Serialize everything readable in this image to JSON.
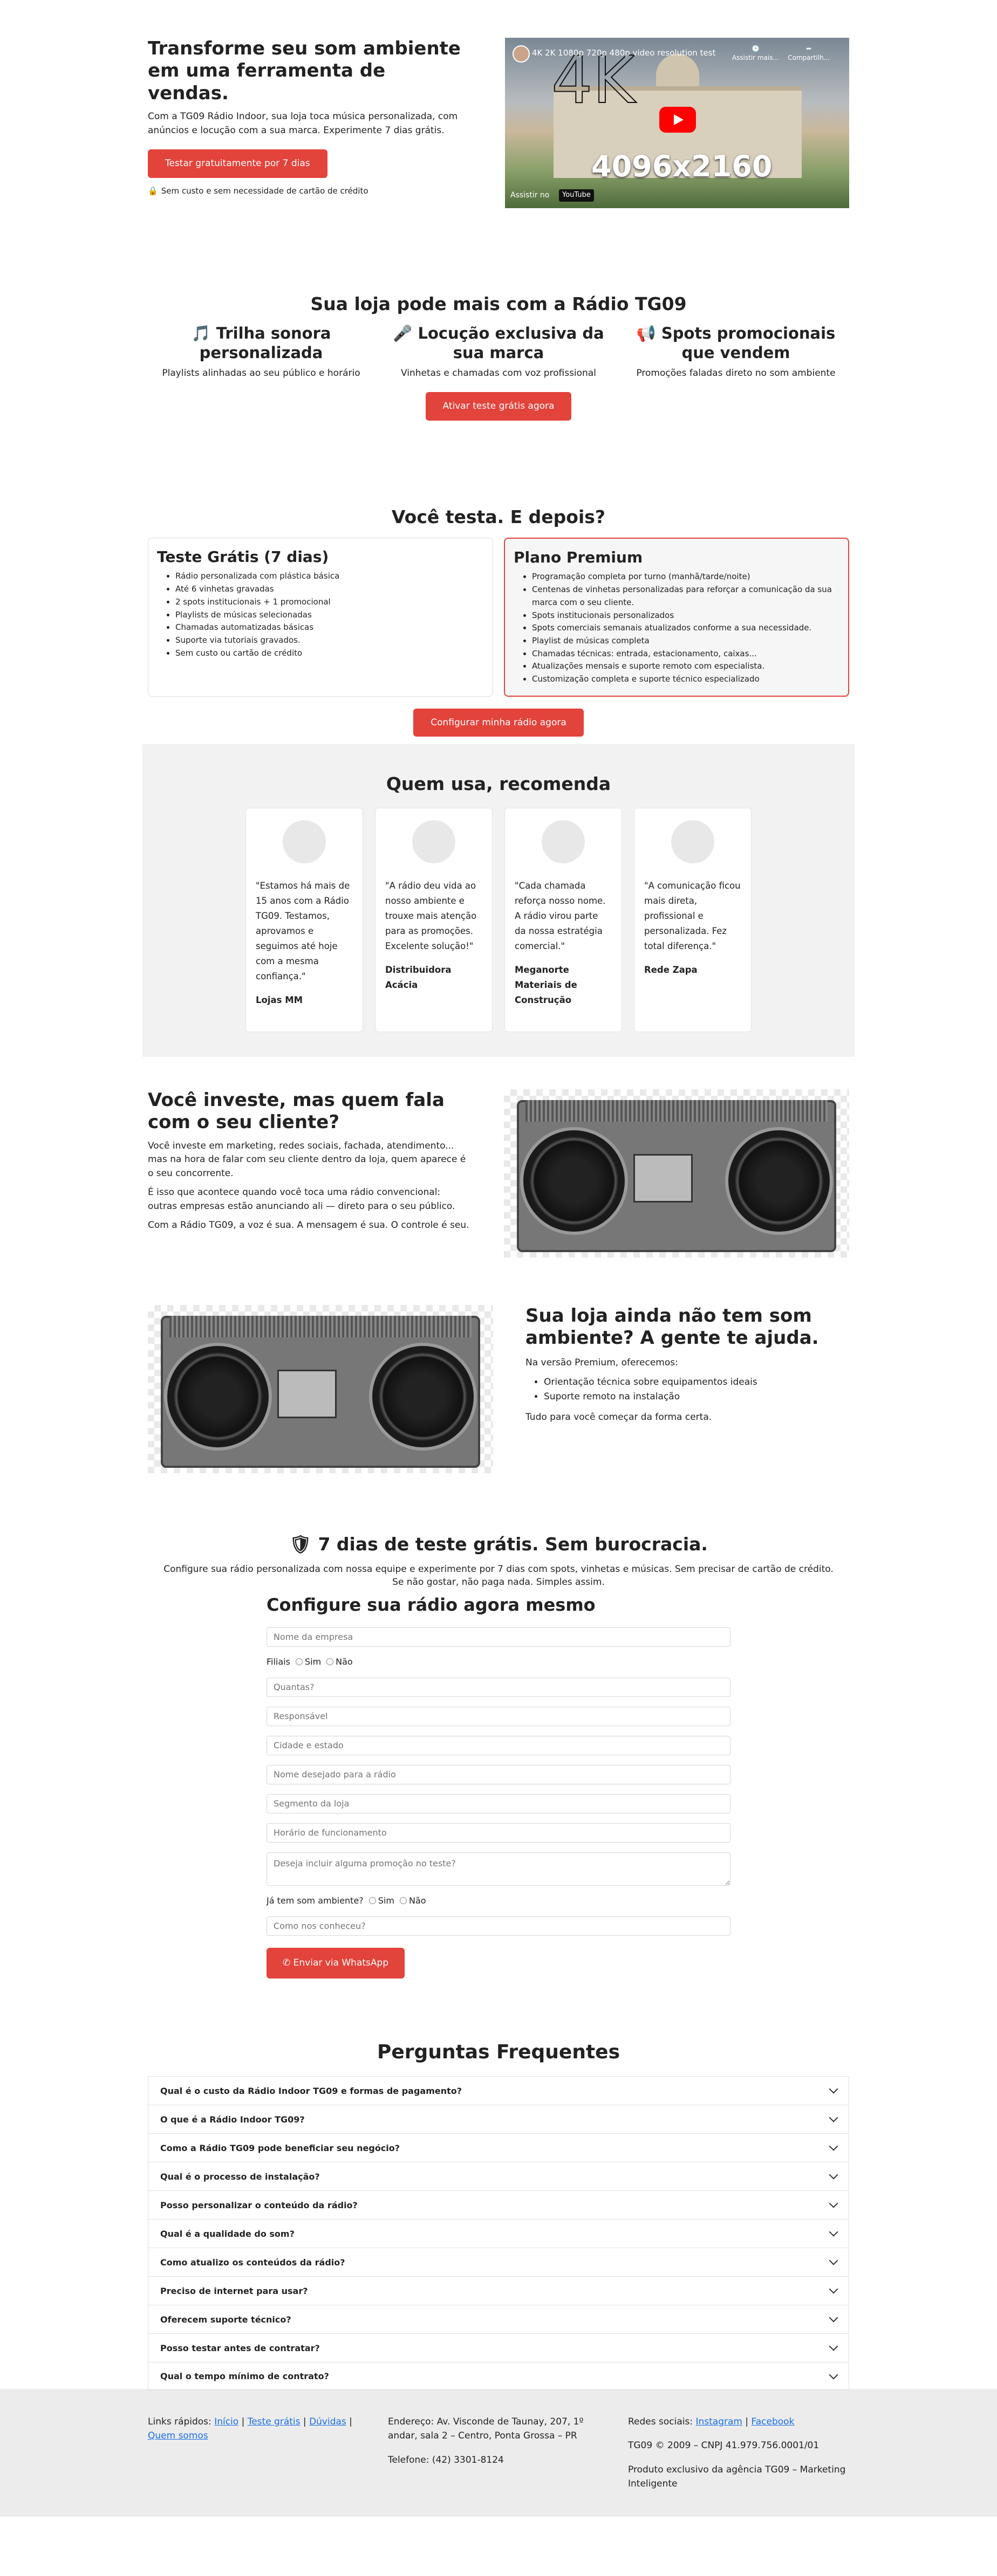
{
  "hero": {
    "title": "Transforme seu som ambiente em uma ferramenta de vendas.",
    "text": "Com a TG09 Rádio Indoor, sua loja toca música personalizada, com anúncios e locução com a sua marca. Experimente 7 dias grátis.",
    "button": "Testar gratuitamente por 7 dias",
    "note": "Sem custo e sem necessidade de cartão de crédito",
    "video": {
      "title": "4K 2K 1080p 720p 480p video resolution test",
      "big_label": "4K",
      "resolution": "4096x2160",
      "watch_on": "Assistir no",
      "platform": "YouTube",
      "later": "Assistir mais...",
      "share": "Compartilh..."
    }
  },
  "features": {
    "title": "Sua loja pode mais com a Rádio TG09",
    "items": [
      {
        "icon": "🎵",
        "title": "Trilha sonora personalizada",
        "text": "Playlists alinhadas ao seu público e horário"
      },
      {
        "icon": "🎤",
        "title": "Locução exclusiva da sua marca",
        "text": "Vinhetas e chamadas com voz profissional"
      },
      {
        "icon": "📢",
        "title": "Spots promocionais que vendem",
        "text": "Promoções faladas direto no som ambiente"
      }
    ],
    "button": "Ativar teste grátis agora"
  },
  "plans": {
    "title": "Você testa. E depois?",
    "free": {
      "title": "Teste Grátis (7 dias)",
      "items": [
        "Rádio personalizada com plástica básica",
        "Até 6 vinhetas gravadas",
        "2 spots institucionais + 1 promocional",
        "Playlists de músicas selecionadas",
        "Chamadas automatizadas básicas",
        "Suporte via tutoriais gravados.",
        "Sem custo ou cartão de crédito"
      ]
    },
    "premium": {
      "title": "Plano Premium",
      "items": [
        "Programação completa por turno (manhã/tarde/noite)",
        "Centenas de vinhetas personalizadas para reforçar a comunicação da sua marca com o seu cliente.",
        "Spots institucionais personalizados",
        "Spots comerciais semanais atualizados conforme a sua necessidade.",
        "Playlist de músicas completa",
        "Chamadas técnicas: entrada, estacionamento, caixas...",
        "Atualizações mensais e suporte remoto com especialista.",
        "Customização completa e suporte técnico especializado"
      ]
    },
    "button": "Configurar minha rádio agora"
  },
  "testimonials": {
    "title": "Quem usa, recomenda",
    "items": [
      {
        "quote": "\"Estamos há mais de 15 anos com a Rádio TG09. Testamos, aprovamos e seguimos até hoje com a mesma confiança.\"",
        "author": "Lojas MM"
      },
      {
        "quote": "\"A rádio deu vida ao nosso ambiente e trouxe mais atenção para as promoções. Excelente solução!\"",
        "author": "Distribuidora Acácia"
      },
      {
        "quote": "\"Cada chamada reforça nosso nome. A rádio virou parte da nossa estratégia comercial.\"",
        "author": "Meganorte Materiais de Construção"
      },
      {
        "quote": "\"A comunicação ficou mais direta, profissional e personalizada. Fez total diferença.\"",
        "author": "Rede Zapa"
      }
    ]
  },
  "invest": {
    "title": "Você investe, mas quem fala com o seu cliente?",
    "p1": "Você investe em marketing, redes sociais, fachada, atendimento... mas na hora de falar com seu cliente dentro da loja, quem aparece é o seu concorrente.",
    "p2": "É isso que acontece quando você toca uma rádio convencional: outras empresas estão anunciando ali — direto para o seu público.",
    "p3": "Com a Rádio TG09, a voz é sua. A mensagem é sua. O controle é seu."
  },
  "need": {
    "title": "Sua loja ainda não tem som ambiente? A gente te ajuda.",
    "intro": "Na versão Premium, oferecemos:",
    "items": [
      "Orientação técnica sobre equipamentos ideais",
      "Suporte remoto na instalação"
    ],
    "outro": "Tudo para você começar da forma certa."
  },
  "trial": {
    "title": "7 dias de teste grátis. Sem burocracia.",
    "text": "Configure sua rádio personalizada com nossa equipe e experimente por 7 dias com spots, vinhetas e músicas. Sem precisar de cartão de crédito. Se não gostar, não paga nada. Simples assim.",
    "form_title": "Configure sua rádio agora mesmo",
    "company": "Nome da empresa",
    "branches_label": "Filiais",
    "yes": "Sim",
    "no": "Não",
    "how_many": "Quantas?",
    "responsible": "Responsável",
    "city": "Cidade e estado",
    "radio_name": "Nome desejado para a rádio",
    "segment": "Segmento da loja",
    "hours": "Horário de funcionamento",
    "promo": "Deseja incluir alguma promoção no teste?",
    "has_sound_label": "Já tem som ambiente?",
    "how_found": "Como nos conheceu?",
    "submit": "Enviar via WhatsApp"
  },
  "faq": {
    "title": "Perguntas Frequentes",
    "items": [
      "Qual é o custo da Rádio Indoor TG09 e formas de pagamento?",
      "O que é a Rádio Indoor TG09?",
      "Como a Rádio TG09 pode beneficiar seu negócio?",
      "Qual é o processo de instalação?",
      "Posso personalizar o conteúdo da rádio?",
      "Qual é a qualidade do som?",
      "Como atualizo os conteúdos da rádio?",
      "Preciso de internet para usar?",
      "Oferecem suporte técnico?",
      "Posso testar antes de contratar?",
      "Qual o tempo mínimo de contrato?"
    ]
  },
  "footer": {
    "links_label": "Links rápidos:",
    "links": [
      "Início",
      "Teste grátis",
      "Dúvidas",
      "Quem somos"
    ],
    "address": "Endereço: Av. Visconde de Taunay, 207, 1º andar, sala 2 – Centro, Ponta Grossa – PR",
    "phone": "Telefone: (42) 3301-8124",
    "social_label": "Redes sociais:",
    "social": [
      "Instagram",
      "Facebook"
    ],
    "copyright": "TG09 © 2009 – CNPJ 41.979.756.0001/01",
    "agency": "Produto exclusivo da agência TG09 – Marketing Inteligente"
  }
}
